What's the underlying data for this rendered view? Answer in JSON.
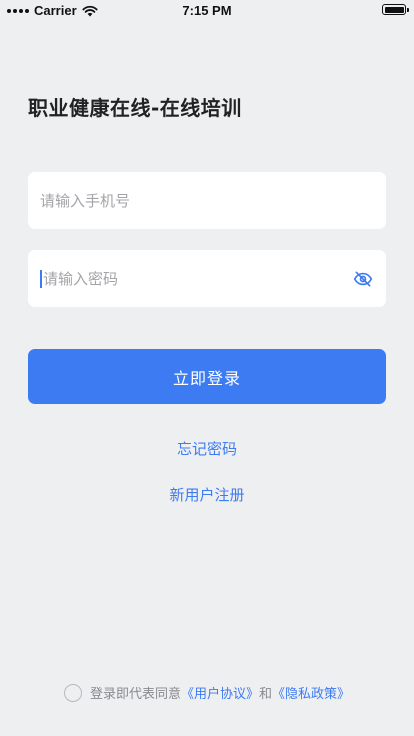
{
  "status_bar": {
    "carrier": "Carrier",
    "time": "7:15 PM"
  },
  "title": "职业健康在线-在线培训",
  "phone_input": {
    "placeholder": "请输入手机号",
    "value": ""
  },
  "password_input": {
    "placeholder": "请输入密码",
    "value": "",
    "toggle_icon": "eye-off-icon"
  },
  "login_button": {
    "label": "立即登录"
  },
  "links": {
    "forgot_password": "忘记密码",
    "register": "新用户注册"
  },
  "agreement": {
    "prefix": "登录即代表同意",
    "user_agreement": "《用户协议》",
    "and": "和",
    "privacy_policy": "《隐私政策》"
  },
  "colors": {
    "accent": "#3d7bf3",
    "background": "#eeeff1",
    "card": "#ffffff"
  }
}
